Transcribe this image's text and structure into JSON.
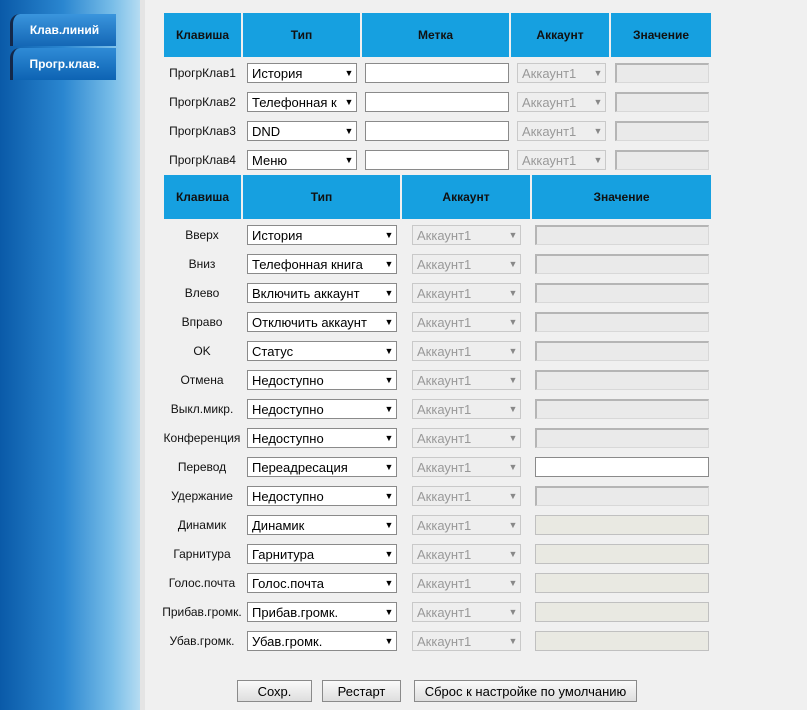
{
  "sidebar": {
    "tabs": [
      {
        "label": "Клав.линий"
      },
      {
        "label": "Прогр.клав."
      }
    ]
  },
  "prog_table": {
    "headers": {
      "key": "Клавиша",
      "type": "Тип",
      "label": "Метка",
      "account": "Аккаунт",
      "value": "Значение"
    },
    "rows": [
      {
        "key": "ПрогрКлав1",
        "type": "История",
        "label": "",
        "account": "Аккаунт1",
        "value": ""
      },
      {
        "key": "ПрогрКлав2",
        "type": "Телефонная к",
        "label": "",
        "account": "Аккаунт1",
        "value": ""
      },
      {
        "key": "ПрогрКлав3",
        "type": "DND",
        "label": "",
        "account": "Аккаунт1",
        "value": ""
      },
      {
        "key": "ПрогрКлав4",
        "type": "Меню",
        "label": "",
        "account": "Аккаунт1",
        "value": ""
      }
    ]
  },
  "nav_table": {
    "headers": {
      "key": "Клавиша",
      "type": "Тип",
      "account": "Аккаунт",
      "value": "Значение"
    },
    "rows": [
      {
        "key": "Вверх",
        "type": "История",
        "account": "Аккаунт1",
        "value": ""
      },
      {
        "key": "Вниз",
        "type": "Телефонная книга",
        "account": "Аккаунт1",
        "value": ""
      },
      {
        "key": "Влево",
        "type": "Включить аккаунт",
        "account": "Аккаунт1",
        "value": ""
      },
      {
        "key": "Вправо",
        "type": "Отключить аккаунт",
        "account": "Аккаунт1",
        "value": ""
      },
      {
        "key": "OK",
        "type": "Статус",
        "account": "Аккаунт1",
        "value": ""
      },
      {
        "key": "Отмена",
        "type": "Недоступно",
        "account": "Аккаунт1",
        "value": ""
      },
      {
        "key": "Выкл.микр.",
        "type": "Недоступно",
        "account": "Аккаунт1",
        "value": ""
      },
      {
        "key": "Конференция",
        "type": "Недоступно",
        "account": "Аккаунт1",
        "value": ""
      },
      {
        "key": "Перевод",
        "type": "Переадресация",
        "account": "Аккаунт1",
        "value": ""
      },
      {
        "key": "Удержание",
        "type": "Недоступно",
        "account": "Аккаунт1",
        "value": ""
      },
      {
        "key": "Динамик",
        "type": "Динамик",
        "account": "Аккаунт1",
        "value": ""
      },
      {
        "key": "Гарнитура",
        "type": "Гарнитура",
        "account": "Аккаунт1",
        "value": ""
      },
      {
        "key": "Голос.почта",
        "type": "Голос.почта",
        "account": "Аккаунт1",
        "value": ""
      },
      {
        "key": "Прибав.громк.",
        "type": "Прибав.громк.",
        "account": "Аккаунт1",
        "value": ""
      },
      {
        "key": "Убав.громк.",
        "type": "Убав.громк.",
        "account": "Аккаунт1",
        "value": ""
      }
    ]
  },
  "buttons": {
    "save": "Сохр.",
    "restart": "Рестарт",
    "reset": "Сброс к настройке по умолчанию"
  },
  "colors": {
    "header": "#16a0e0",
    "sidebar": "#0a5aa8"
  },
  "icons": {
    "dropdown": "chevron-down-icon"
  }
}
